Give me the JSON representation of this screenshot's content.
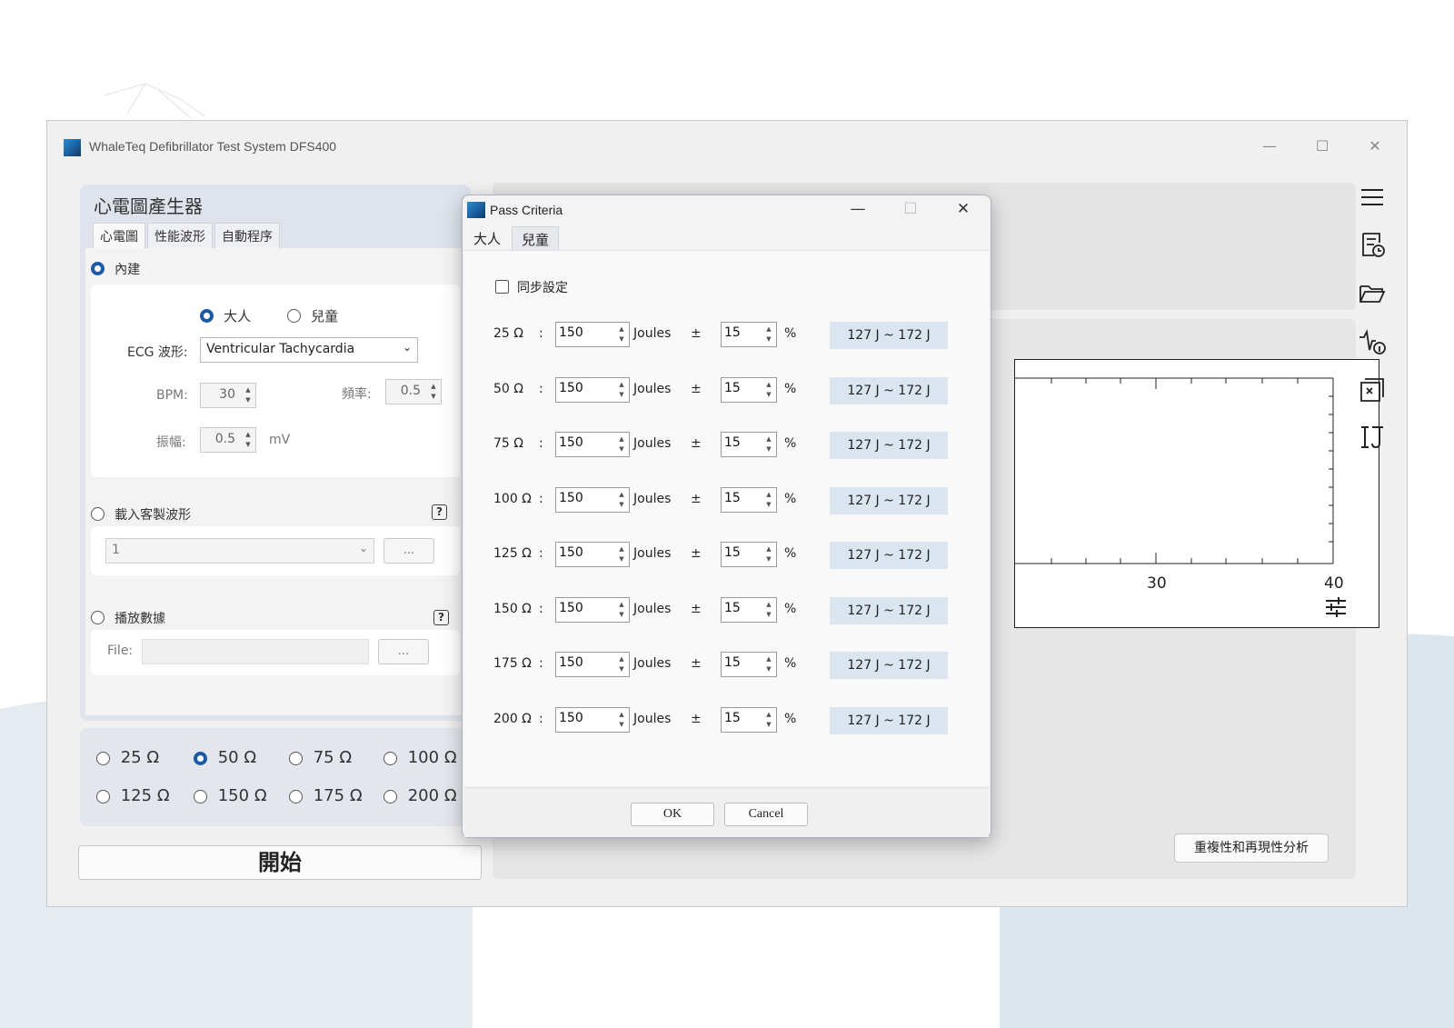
{
  "app": {
    "title": "WhaleTeq Defibrillator Test System DFS400",
    "minimize": "—",
    "maximize": "☐",
    "close": "✕"
  },
  "ecg_panel": {
    "title": "心電圖產生器",
    "tabs": [
      "心電圖",
      "性能波形",
      "自動程序"
    ],
    "builtin_label": "內建",
    "adult_label": "大人",
    "child_label": "兒童",
    "waveform_label": "ECG 波形:",
    "waveform_value": "Ventricular Tachycardia",
    "bpm_label": "BPM:",
    "bpm_value": "30",
    "freq_label": "頻率:",
    "freq_value": "0.5",
    "amp_label": "振幅:",
    "amp_value": "0.5",
    "amp_unit": "mV",
    "custom_label": "載入客製波形",
    "custom_value": "1",
    "browse_label": "...",
    "playback_label": "播放數據",
    "file_label": "File:",
    "help_icon": "?"
  },
  "impedance": {
    "options": [
      "25 Ω",
      "50 Ω",
      "75 Ω",
      "100 Ω",
      "125 Ω",
      "150 Ω",
      "175 Ω",
      "200 Ω"
    ],
    "selected_index": 1
  },
  "start_label": "開始",
  "plot": {
    "ticks": [
      "30",
      "40"
    ]
  },
  "repeat_label": "重複性和再現性分析",
  "dialog": {
    "title": "Pass Criteria",
    "tabs": [
      "大人",
      "兒童"
    ],
    "sync_label": "同步設定",
    "colon": ":",
    "joules_label": "Joules",
    "pm_label": "±",
    "pct_label": "%",
    "rows": [
      {
        "impedance": "25 Ω",
        "energy": "150",
        "tolerance": "15",
        "range": "127 J ~ 172 J"
      },
      {
        "impedance": "50 Ω",
        "energy": "150",
        "tolerance": "15",
        "range": "127 J ~ 172 J"
      },
      {
        "impedance": "75 Ω",
        "energy": "150",
        "tolerance": "15",
        "range": "127 J ~ 172 J"
      },
      {
        "impedance": "100 Ω",
        "energy": "150",
        "tolerance": "15",
        "range": "127 J ~ 172 J"
      },
      {
        "impedance": "125 Ω",
        "energy": "150",
        "tolerance": "15",
        "range": "127 J ~ 172 J"
      },
      {
        "impedance": "150 Ω",
        "energy": "150",
        "tolerance": "15",
        "range": "127 J ~ 172 J"
      },
      {
        "impedance": "175 Ω",
        "energy": "150",
        "tolerance": "15",
        "range": "127 J ~ 172 J"
      },
      {
        "impedance": "200 Ω",
        "energy": "150",
        "tolerance": "15",
        "range": "127 J ~ 172 J"
      }
    ],
    "ok_label": "OK",
    "cancel_label": "Cancel"
  },
  "icons": {
    "menu": "menu-icon",
    "report": "report-history-icon",
    "open": "folder-open-icon",
    "waveform_info": "waveform-info-icon",
    "export": "export-icon",
    "calibrate": "calibration-icon",
    "settings": "sliders-icon"
  },
  "colors": {
    "accent": "#1c5aa8",
    "range_bg": "#dbe5f0",
    "panel_bg": "#dfe4ec"
  }
}
